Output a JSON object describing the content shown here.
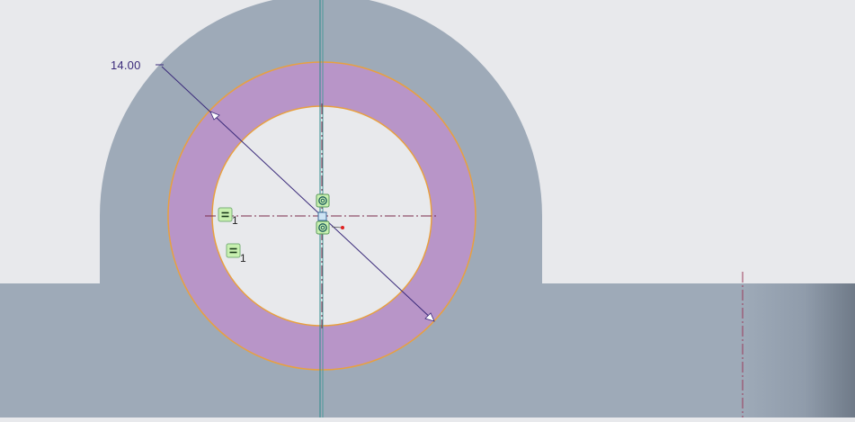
{
  "dimension": {
    "diameter_value": "14.00"
  },
  "constraints": {
    "equal_1_index": "1",
    "equal_2_index": "1"
  },
  "colors": {
    "background": "#e8e9ec",
    "part_body": "#9eaab8",
    "annulus_fill": "#b895c8",
    "circle_edge": "#e8a040",
    "dimension_line": "#3a2a7a",
    "centerline": "#7a2a4a",
    "axis_line": "#2a8a8a",
    "constraint_badge": "#c8f0b0"
  }
}
